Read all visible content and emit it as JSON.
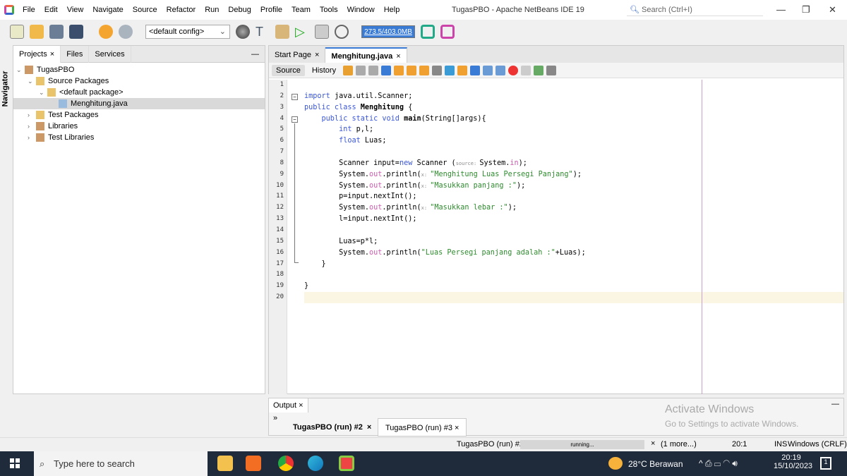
{
  "window": {
    "title": "TugasPBO - Apache NetBeans IDE 19",
    "search_placeholder": "Search (Ctrl+I)"
  },
  "menu": [
    "File",
    "Edit",
    "View",
    "Navigate",
    "Source",
    "Refactor",
    "Run",
    "Debug",
    "Profile",
    "Team",
    "Tools",
    "Window",
    "Help"
  ],
  "toolbar": {
    "config": "<default config>",
    "memory": "273.5/403.0MB"
  },
  "navigator_label": "Navigator",
  "project_tabs": [
    "Projects",
    "Files",
    "Services"
  ],
  "tree": [
    {
      "label": "TugasPBO",
      "level": 0,
      "arrow": "v"
    },
    {
      "label": "Source Packages",
      "level": 1,
      "arrow": "v"
    },
    {
      "label": "<default package>",
      "level": 2,
      "arrow": "v"
    },
    {
      "label": "Menghitung.java",
      "level": 3,
      "arrow": ""
    },
    {
      "label": "Test Packages",
      "level": 1,
      "arrow": ">"
    },
    {
      "label": "Libraries",
      "level": 1,
      "arrow": ">"
    },
    {
      "label": "Test Libraries",
      "level": 1,
      "arrow": ">"
    }
  ],
  "editor_tabs": [
    "Start Page",
    "Menghitung.java"
  ],
  "editor_modes": [
    "Source",
    "History"
  ],
  "code": [
    [],
    [
      [
        "import ",
        "kw"
      ],
      [
        "java.util.Scanner;",
        ""
      ]
    ],
    [
      [
        "public class ",
        "kw"
      ],
      [
        "Menghitung",
        "bold"
      ],
      [
        " {",
        ""
      ]
    ],
    [
      [
        "    public static void ",
        "kw"
      ],
      [
        "main",
        "bold"
      ],
      [
        "(String[]args){",
        ""
      ]
    ],
    [
      [
        "        int ",
        "kw"
      ],
      [
        "p,l;",
        ""
      ]
    ],
    [
      [
        "        float ",
        "kw"
      ],
      [
        "Luas;",
        ""
      ]
    ],
    [],
    [
      [
        "        Scanner input=",
        ""
      ],
      [
        "new",
        "kw"
      ],
      [
        " Scanner (",
        ""
      ],
      [
        "source: ",
        "hint"
      ],
      [
        "System.",
        ""
      ],
      [
        "in",
        "fld"
      ],
      [
        ");",
        ""
      ]
    ],
    [
      [
        "        System.",
        ""
      ],
      [
        "out",
        "fld"
      ],
      [
        ".println(",
        ""
      ],
      [
        "x: ",
        "hint"
      ],
      [
        "\"Menghitung Luas Persegi Panjang\"",
        "str"
      ],
      [
        ");",
        ""
      ]
    ],
    [
      [
        "        System.",
        ""
      ],
      [
        "out",
        "fld"
      ],
      [
        ".println(",
        ""
      ],
      [
        "x: ",
        "hint"
      ],
      [
        "\"Masukkan panjang :\"",
        "str"
      ],
      [
        ");",
        ""
      ]
    ],
    [
      [
        "        p=input.nextInt();",
        ""
      ]
    ],
    [
      [
        "        System.",
        ""
      ],
      [
        "out",
        "fld"
      ],
      [
        ".println(",
        ""
      ],
      [
        "x: ",
        "hint"
      ],
      [
        "\"Masukkan lebar :\"",
        "str"
      ],
      [
        ");",
        ""
      ]
    ],
    [
      [
        "        l=input.nextInt();",
        ""
      ]
    ],
    [],
    [
      [
        "        Luas=p*l;",
        ""
      ]
    ],
    [
      [
        "        System.",
        ""
      ],
      [
        "out",
        "fld"
      ],
      [
        ".println(",
        ""
      ],
      [
        "\"Luas Persegi panjang adalah :\"",
        "str"
      ],
      [
        "+Luas);",
        ""
      ]
    ],
    [
      [
        "    }",
        ""
      ]
    ],
    [],
    [
      [
        "}",
        ""
      ]
    ],
    []
  ],
  "output": {
    "title": "Output",
    "tabs": [
      "TugasPBO (run) #2",
      "TugasPBO (run) #3"
    ]
  },
  "watermark": {
    "title": "Activate Windows",
    "subtitle": "Go to Settings to activate Windows."
  },
  "status": {
    "task": "TugasPBO (run) #2",
    "progress": "running...",
    "more": "(1 more...)",
    "position": "20:1",
    "mode": "INS",
    "line_ending": "Windows (CRLF)"
  },
  "taskbar": {
    "search": "Type here to search",
    "weather": "28°C  Berawan",
    "time": "20:19",
    "date": "15/10/2023",
    "notifications": "1"
  }
}
